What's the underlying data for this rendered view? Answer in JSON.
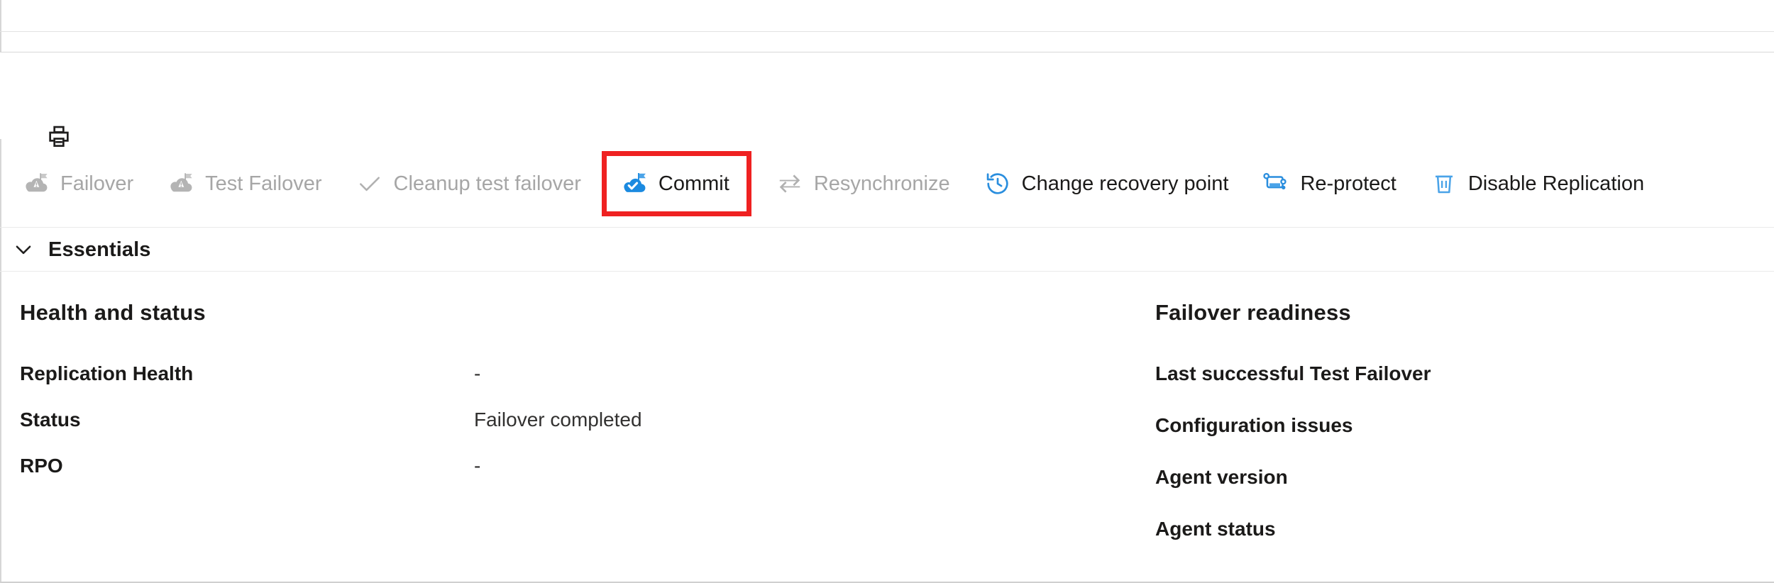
{
  "commandstrip": {
    "partial_icon": "cloud-partial-icon",
    "print_label": "Print",
    "print_icon": "print-icon"
  },
  "toolbar": {
    "commands": [
      {
        "label": "Failover",
        "icon": "cloud-failover-icon",
        "disabled": true,
        "highlighted": false
      },
      {
        "label": "Test Failover",
        "icon": "cloud-test-failover-icon",
        "disabled": true,
        "highlighted": false
      },
      {
        "label": "Cleanup test failover",
        "icon": "checkmark-icon",
        "disabled": true,
        "highlighted": false
      },
      {
        "label": "Commit",
        "icon": "cloud-commit-icon",
        "disabled": false,
        "highlighted": true
      },
      {
        "label": "Resynchronize",
        "icon": "sync-arrows-icon",
        "disabled": true,
        "highlighted": false
      },
      {
        "label": "Change recovery point",
        "icon": "history-clock-icon",
        "disabled": false,
        "highlighted": false
      },
      {
        "label": "Re-protect",
        "icon": "re-protect-icon",
        "disabled": false,
        "highlighted": false
      },
      {
        "label": "Disable Replication",
        "icon": "trash-icon",
        "disabled": false,
        "highlighted": false
      }
    ]
  },
  "essentials": {
    "label": "Essentials",
    "expanded": true,
    "chevron_icon": "chevron-down-icon"
  },
  "health_and_status": {
    "title": "Health and status",
    "rows": [
      {
        "key": "Replication Health",
        "value": "-"
      },
      {
        "key": "Status",
        "value": "Failover completed"
      },
      {
        "key": "RPO",
        "value": "-"
      }
    ]
  },
  "failover_readiness": {
    "title": "Failover readiness",
    "rows": [
      {
        "key": "Last successful Test Failover",
        "value": ""
      },
      {
        "key": "Configuration issues",
        "value": ""
      },
      {
        "key": "Agent version",
        "value": ""
      },
      {
        "key": "Agent status",
        "value": ""
      }
    ]
  },
  "colors": {
    "accent_blue": "#0078d4",
    "highlight_red": "#ef2121",
    "disabled_gray": "#a6a6a6",
    "text_dark": "#1b1a19"
  }
}
